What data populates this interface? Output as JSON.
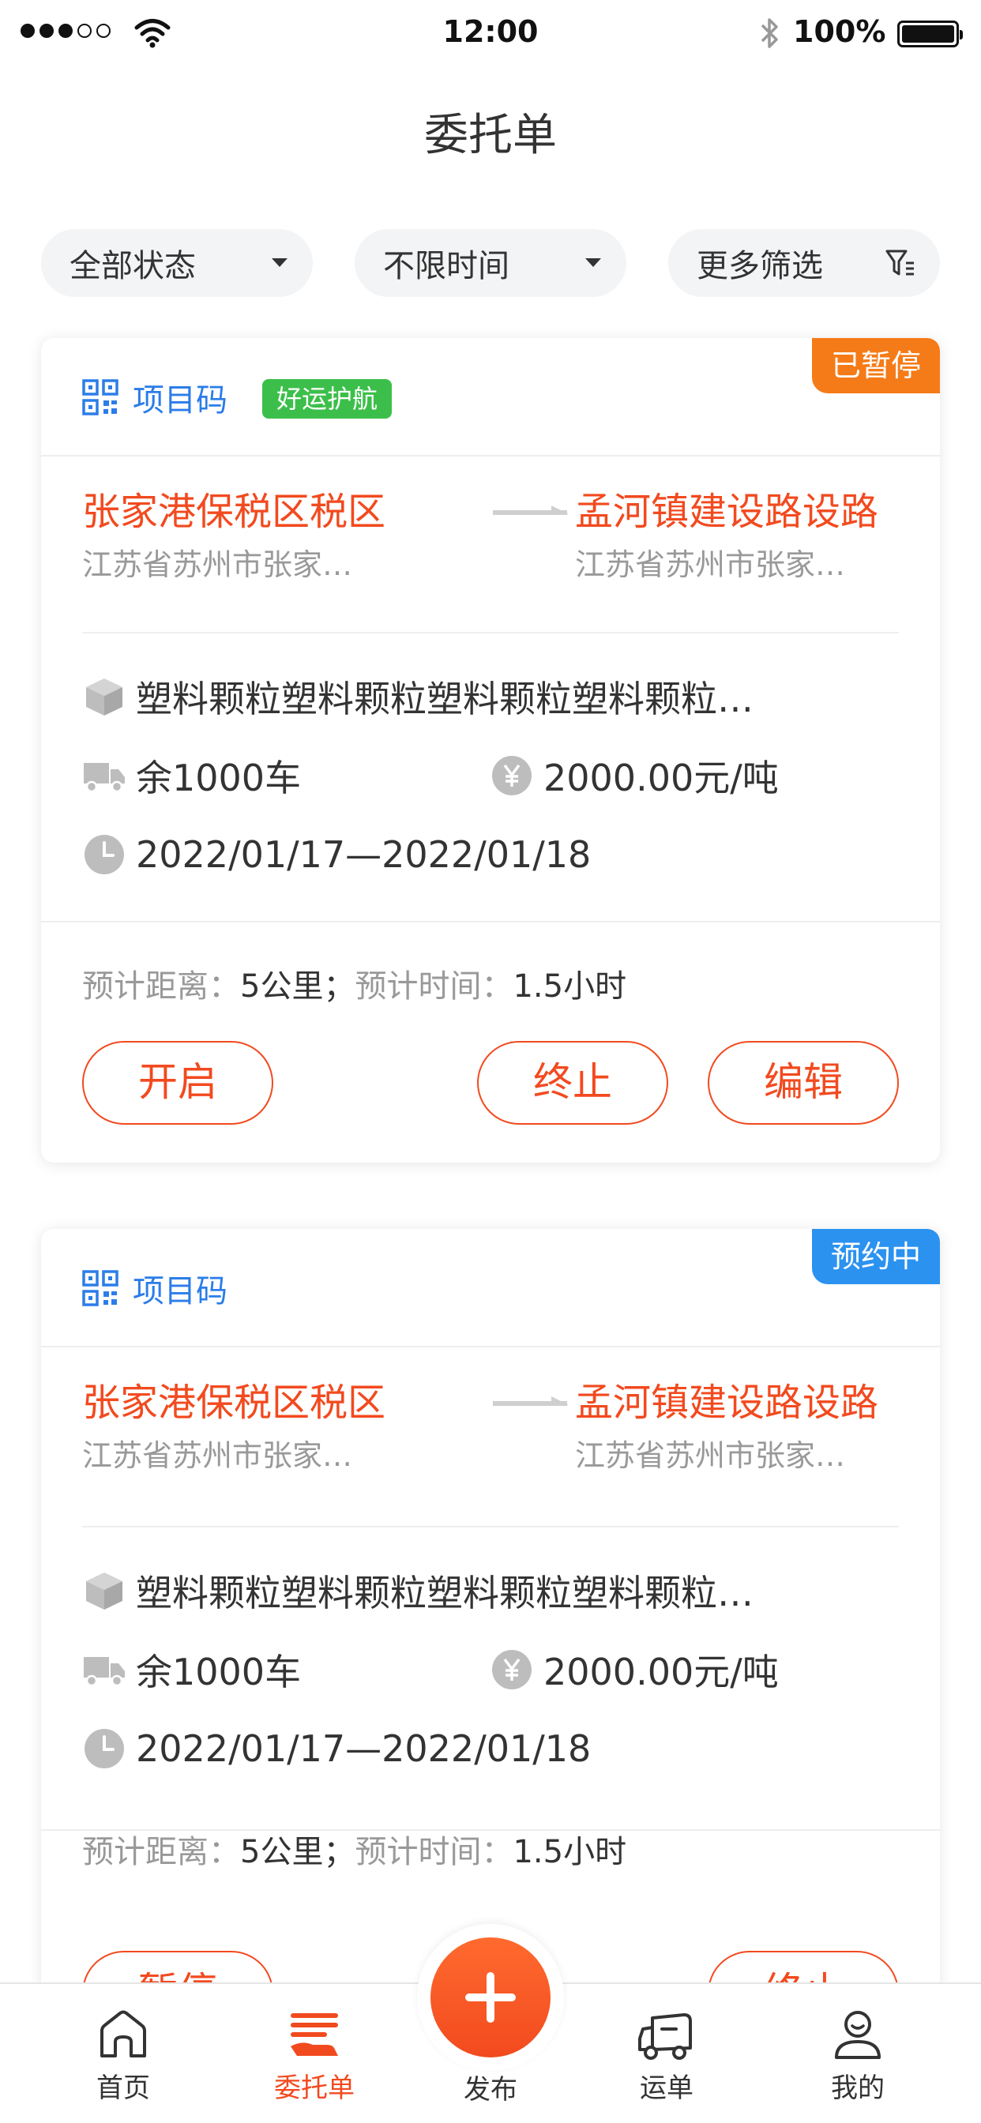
{
  "status_bar": {
    "time": "12:00",
    "battery": "100%"
  },
  "title": "委托单",
  "filters": [
    {
      "label": "全部状态"
    },
    {
      "label": "不限时间"
    },
    {
      "label": "更多筛选"
    }
  ],
  "orders": [
    {
      "project_code": "项目码",
      "badge": "好运护航",
      "state": "已暂停",
      "from_name": "张家港保税区税区",
      "from_address": "江苏省苏州市张家…",
      "to_name": "孟河镇建设路设路",
      "to_address": "江苏省苏州市张家…",
      "goods": "塑料颗粒塑料颗粒塑料颗粒塑料颗粒…",
      "remaining": "余1000车",
      "price": "2000.00元/吨",
      "date_range": "2022/01/17—2022/01/18",
      "distance_label": "预计距离：",
      "distance": "5公里；",
      "duration_label": "预计时间：",
      "duration": "1.5小时",
      "actions": [
        "开启",
        "终止",
        "编辑"
      ]
    },
    {
      "project_code": "项目码",
      "state": "预约中",
      "from_name": "张家港保税区税区",
      "from_address": "江苏省苏州市张家…",
      "to_name": "孟河镇建设路设路",
      "to_address": "江苏省苏州市张家…",
      "goods": "塑料颗粒塑料颗粒塑料颗粒塑料颗粒…",
      "remaining": "余1000车",
      "price": "2000.00元/吨",
      "date_range": "2022/01/17—2022/01/18",
      "distance_label": "预计距离：",
      "distance": "5公里；",
      "duration_label": "预计时间：",
      "duration": "1.5小时",
      "actions": [
        "暂停",
        "终止"
      ]
    }
  ],
  "tabbar": {
    "home": "首页",
    "orders": "委托单",
    "publish": "发布",
    "waybill": "运单",
    "mine": "我的"
  },
  "colors": {
    "accent": "#f24a1f",
    "paused": "#f57b18",
    "booking": "#2b92f0",
    "badge": "#3cbf4a",
    "link": "#2b7de9"
  }
}
